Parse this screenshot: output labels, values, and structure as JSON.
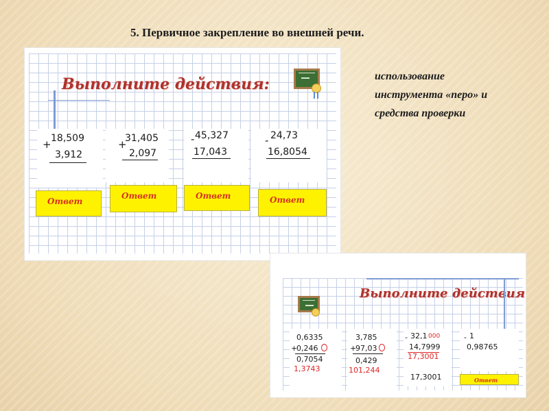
{
  "title": "5.  Первичное закрепление во внешней речи.",
  "side_note": {
    "lines": [
      "использование",
      "инструмента «перо» и",
      "средства проверки"
    ]
  },
  "card1": {
    "heading": "Выполните действия:",
    "board_label": "",
    "problems": [
      {
        "op": "+",
        "a": "18,509",
        "b": "3,912",
        "answer_label": "Ответ"
      },
      {
        "op": "+",
        "a": "31,405",
        "b": "2,097",
        "answer_label": "Ответ"
      },
      {
        "op": "-",
        "a": "45,327",
        "b": "17,043",
        "answer_label": "Ответ"
      },
      {
        "op": "-",
        "a": "24,73",
        "b": "16,8054",
        "answer_label": "Ответ"
      }
    ]
  },
  "card2": {
    "heading": "Выполните действия:",
    "problems": [
      {
        "op": "+",
        "a": "0,6335",
        "b": "0,246",
        "result": "0,7054",
        "handwritten": "1,3743"
      },
      {
        "op": "+",
        "a": "3,785",
        "b": "97,03",
        "result": "0,429",
        "handwritten": "101,244"
      },
      {
        "op": "-",
        "a": "32,1",
        "b": "14,7999",
        "result": "17,3001",
        "handwritten": "17,3001",
        "marks": "000"
      },
      {
        "op": "-",
        "a": "1",
        "b": "0,98765",
        "result": "",
        "handwritten": "",
        "answer_label": "Ответ"
      }
    ]
  },
  "colors": {
    "heading": "#b0312b",
    "answer_bg": "#fff200",
    "answer_text": "#d6331f",
    "pen": "#e02424"
  }
}
